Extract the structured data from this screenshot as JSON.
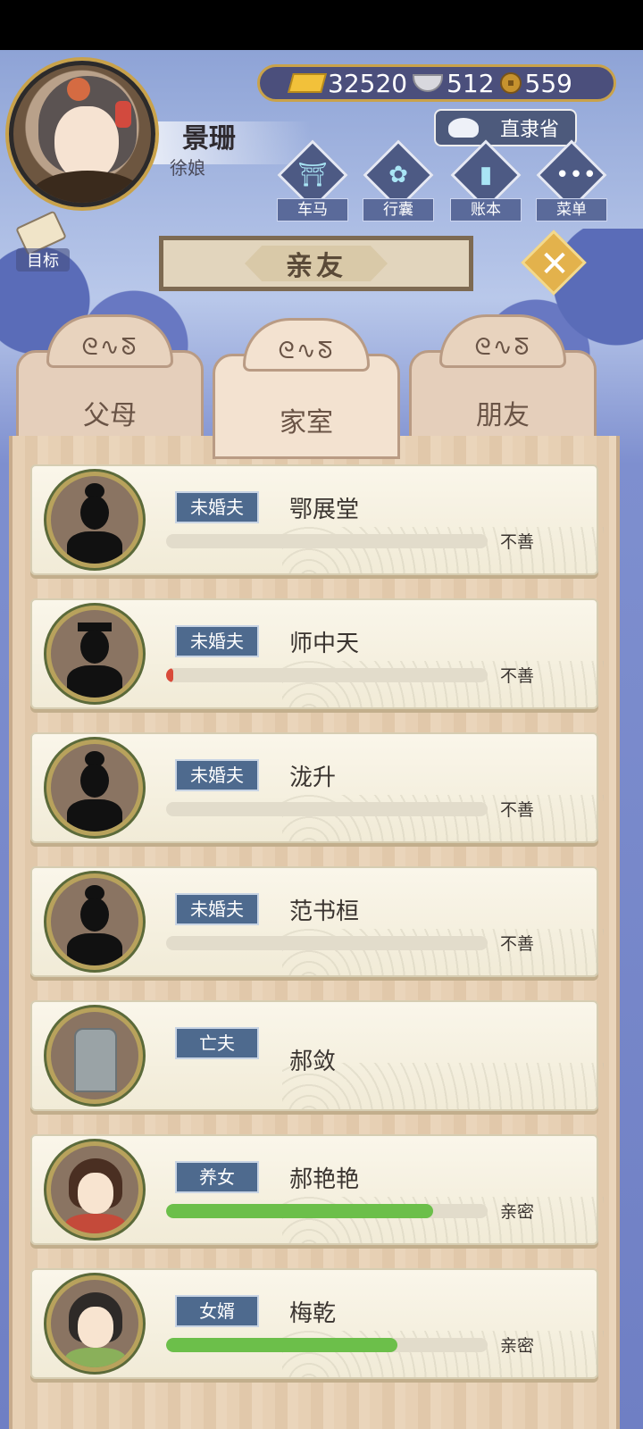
{
  "player": {
    "name": "景珊",
    "title": "徐娘"
  },
  "currency": {
    "gold": "32520",
    "silver": "512",
    "coins": "559"
  },
  "province": "直隶省",
  "menu": {
    "carriage": "车马",
    "bag": "行囊",
    "ledger": "账本",
    "menu": "菜单",
    "goal": "目标"
  },
  "page_title": "亲友",
  "tabs": [
    "父母",
    "家室",
    "朋友"
  ],
  "active_tab": "家室",
  "relatives": [
    {
      "role": "未婚夫",
      "name": "鄂展堂",
      "status": "不善",
      "bar": 0.0,
      "bar_color": "#d94a3a",
      "avatar": "silhouette-bun"
    },
    {
      "role": "未婚夫",
      "name": "师中天",
      "status": "不善",
      "bar": 0.02,
      "bar_color": "#d94a3a",
      "avatar": "silhouette-hat"
    },
    {
      "role": "未婚夫",
      "name": "泷升",
      "status": "不善",
      "bar": 0.0,
      "bar_color": "#d94a3a",
      "avatar": "silhouette-crown"
    },
    {
      "role": "未婚夫",
      "name": "范书桓",
      "status": "不善",
      "bar": 0.0,
      "bar_color": "#d94a3a",
      "avatar": "silhouette-bun"
    },
    {
      "role": "亡夫",
      "name": "郝敛",
      "status": "",
      "bar": null,
      "bar_color": "",
      "avatar": "tombstone"
    },
    {
      "role": "养女",
      "name": "郝艳艳",
      "status": "亲密",
      "bar": 0.83,
      "bar_color": "#6cbf4a",
      "avatar": "portrait-girl"
    },
    {
      "role": "女婿",
      "name": "梅乾",
      "status": "亲密",
      "bar": 0.72,
      "bar_color": "#6cbf4a",
      "avatar": "portrait-man"
    }
  ]
}
